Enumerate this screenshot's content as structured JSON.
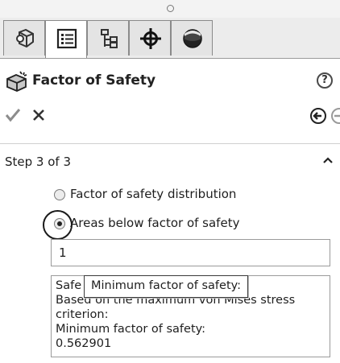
{
  "panel": {
    "title": "Factor of Safety",
    "help_icon": "question-mark-icon",
    "help_label": "?"
  },
  "tabs": [
    {
      "name": "feature-manager",
      "icon": "feature-tree-icon",
      "active": false
    },
    {
      "name": "property-manager",
      "icon": "property-list-icon",
      "active": true
    },
    {
      "name": "configuration-manager",
      "icon": "configuration-icon",
      "active": false
    },
    {
      "name": "dimxpert-manager",
      "icon": "crosshair-icon",
      "active": false
    },
    {
      "name": "display-manager",
      "icon": "sphere-icon",
      "active": false
    }
  ],
  "actions": {
    "ok_icon": "checkmark-icon",
    "cancel_icon": "x-icon",
    "back_icon": "back-arrow-icon",
    "next_icon": "next-arrow-icon"
  },
  "step": {
    "label": "Step 3 of 3",
    "options": [
      {
        "label": "Factor of safety distribution",
        "selected": false
      },
      {
        "label": "Areas below factor of safety",
        "selected": true
      }
    ],
    "value": "1",
    "results_lines": [
      "Safe",
      "Based on the maximum von Mises stress",
      "criterion:",
      "Minimum factor of safety:",
      "0.562901"
    ],
    "tooltip": "Minimum factor of safety:"
  },
  "colors": {
    "active_tab": "#ffffff",
    "inactive_tab": "#e4e4e4",
    "text": "#1e1e1e"
  }
}
